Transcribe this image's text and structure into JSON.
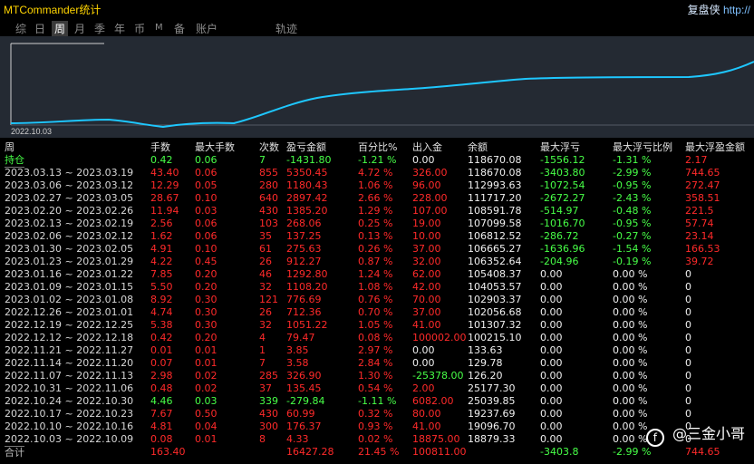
{
  "app": {
    "title": "MTCommander统计",
    "right_title_cn": "复盘侠",
    "right_title_link": "http://"
  },
  "tabs": [
    {
      "label": "综"
    },
    {
      "label": "日"
    },
    {
      "label": "周"
    },
    {
      "label": "月"
    },
    {
      "label": "季"
    },
    {
      "label": "年"
    },
    {
      "label": "币"
    },
    {
      "label": "M"
    },
    {
      "label": "备"
    },
    {
      "label": "账户"
    },
    {
      "label": "轨迹"
    }
  ],
  "active_tab": "周",
  "chart": {
    "start_label": "2022.10.03",
    "line_color": "#1ec7ff",
    "background": "#242a33"
  },
  "table": {
    "headers": [
      "周",
      "手数",
      "最大手数",
      "次数",
      "盈亏金额",
      "百分比%",
      "出入金",
      "余额",
      "最大浮亏",
      "最大浮亏比例",
      "最大浮盈金额"
    ],
    "hold": {
      "label": "持仓",
      "values": [
        "0.42",
        "0.06",
        "7",
        "-1431.80",
        "-1.21 %",
        "0.00",
        "118670.08",
        "-1556.12",
        "-1.31 %",
        "2.17"
      ],
      "colors": [
        "green",
        "green",
        "green",
        "green",
        "green",
        "white",
        "white",
        "green",
        "green",
        "red"
      ]
    },
    "rows": [
      {
        "week": "2023.03.13 ~ 2023.03.19",
        "values": [
          "43.40",
          "0.06",
          "855",
          "5350.45",
          "4.72 %",
          "326.00",
          "118670.08",
          "-3403.80",
          "-2.99 %",
          "744.65"
        ],
        "colors": [
          "red",
          "red",
          "red",
          "red",
          "red",
          "red",
          "white",
          "green",
          "green",
          "red"
        ]
      },
      {
        "week": "2023.03.06 ~ 2023.03.12",
        "values": [
          "12.29",
          "0.05",
          "280",
          "1180.43",
          "1.06 %",
          "96.00",
          "112993.63",
          "-1072.54",
          "-0.95 %",
          "272.47"
        ],
        "colors": [
          "red",
          "red",
          "red",
          "red",
          "red",
          "red",
          "white",
          "green",
          "green",
          "red"
        ]
      },
      {
        "week": "2023.02.27 ~ 2023.03.05",
        "values": [
          "28.67",
          "0.10",
          "640",
          "2897.42",
          "2.66 %",
          "228.00",
          "111717.20",
          "-2672.27",
          "-2.43 %",
          "358.51"
        ],
        "colors": [
          "red",
          "red",
          "red",
          "red",
          "red",
          "red",
          "white",
          "green",
          "green",
          "red"
        ]
      },
      {
        "week": "2023.02.20 ~ 2023.02.26",
        "values": [
          "11.94",
          "0.03",
          "430",
          "1385.20",
          "1.29 %",
          "107.00",
          "108591.78",
          "-514.97",
          "-0.48 %",
          "221.5"
        ],
        "colors": [
          "red",
          "red",
          "red",
          "red",
          "red",
          "red",
          "white",
          "green",
          "green",
          "red"
        ]
      },
      {
        "week": "2023.02.13 ~ 2023.02.19",
        "values": [
          "2.56",
          "0.06",
          "103",
          "268.06",
          "0.25 %",
          "19.00",
          "107099.58",
          "-1016.70",
          "-0.95 %",
          "57.74"
        ],
        "colors": [
          "red",
          "red",
          "red",
          "red",
          "red",
          "red",
          "white",
          "green",
          "green",
          "red"
        ]
      },
      {
        "week": "2023.02.06 ~ 2023.02.12",
        "values": [
          "1.62",
          "0.06",
          "35",
          "137.25",
          "0.13 %",
          "10.00",
          "106812.52",
          "-286.72",
          "-0.27 %",
          "23.14"
        ],
        "colors": [
          "red",
          "red",
          "red",
          "red",
          "red",
          "red",
          "white",
          "green",
          "green",
          "red"
        ]
      },
      {
        "week": "2023.01.30 ~ 2023.02.05",
        "values": [
          "4.91",
          "0.10",
          "61",
          "275.63",
          "0.26 %",
          "37.00",
          "106665.27",
          "-1636.96",
          "-1.54 %",
          "166.53"
        ],
        "colors": [
          "red",
          "red",
          "red",
          "red",
          "red",
          "red",
          "white",
          "green",
          "green",
          "red"
        ]
      },
      {
        "week": "2023.01.23 ~ 2023.01.29",
        "values": [
          "4.22",
          "0.45",
          "26",
          "912.27",
          "0.87 %",
          "32.00",
          "106352.64",
          "-204.96",
          "-0.19 %",
          "39.72"
        ],
        "colors": [
          "red",
          "red",
          "red",
          "red",
          "red",
          "red",
          "white",
          "green",
          "green",
          "red"
        ]
      },
      {
        "week": "2023.01.16 ~ 2023.01.22",
        "values": [
          "7.85",
          "0.20",
          "46",
          "1292.80",
          "1.24 %",
          "62.00",
          "105408.37",
          "0.00",
          "0.00 %",
          "0"
        ],
        "colors": [
          "red",
          "red",
          "red",
          "red",
          "red",
          "red",
          "white",
          "white",
          "white",
          "white"
        ]
      },
      {
        "week": "2023.01.09 ~ 2023.01.15",
        "values": [
          "5.50",
          "0.20",
          "32",
          "1108.20",
          "1.08 %",
          "42.00",
          "104053.57",
          "0.00",
          "0.00 %",
          "0"
        ],
        "colors": [
          "red",
          "red",
          "red",
          "red",
          "red",
          "red",
          "white",
          "white",
          "white",
          "white"
        ]
      },
      {
        "week": "2023.01.02 ~ 2023.01.08",
        "values": [
          "8.92",
          "0.30",
          "121",
          "776.69",
          "0.76 %",
          "70.00",
          "102903.37",
          "0.00",
          "0.00 %",
          "0"
        ],
        "colors": [
          "red",
          "red",
          "red",
          "red",
          "red",
          "red",
          "white",
          "white",
          "white",
          "white"
        ]
      },
      {
        "week": "2022.12.26 ~ 2023.01.01",
        "values": [
          "4.74",
          "0.30",
          "26",
          "712.36",
          "0.70 %",
          "37.00",
          "102056.68",
          "0.00",
          "0.00 %",
          "0"
        ],
        "colors": [
          "red",
          "red",
          "red",
          "red",
          "red",
          "red",
          "white",
          "white",
          "white",
          "white"
        ]
      },
      {
        "week": "2022.12.19 ~ 2022.12.25",
        "values": [
          "5.38",
          "0.30",
          "32",
          "1051.22",
          "1.05 %",
          "41.00",
          "101307.32",
          "0.00",
          "0.00 %",
          "0"
        ],
        "colors": [
          "red",
          "red",
          "red",
          "red",
          "red",
          "red",
          "white",
          "white",
          "white",
          "white"
        ]
      },
      {
        "week": "2022.12.12 ~ 2022.12.18",
        "values": [
          "0.42",
          "0.20",
          "4",
          "79.47",
          "0.08 %",
          "100002.00",
          "100215.10",
          "0.00",
          "0.00 %",
          "0"
        ],
        "colors": [
          "red",
          "red",
          "red",
          "red",
          "red",
          "red",
          "white",
          "white",
          "white",
          "white"
        ]
      },
      {
        "week": "2022.11.21 ~ 2022.11.27",
        "values": [
          "0.01",
          "0.01",
          "1",
          "3.85",
          "2.97 %",
          "0.00",
          "133.63",
          "0.00",
          "0.00 %",
          "0"
        ],
        "colors": [
          "red",
          "red",
          "red",
          "red",
          "red",
          "white",
          "white",
          "white",
          "white",
          "white"
        ]
      },
      {
        "week": "2022.11.14 ~ 2022.11.20",
        "values": [
          "0.07",
          "0.01",
          "7",
          "3.58",
          "2.84 %",
          "0.00",
          "129.78",
          "0.00",
          "0.00 %",
          "0"
        ],
        "colors": [
          "red",
          "red",
          "red",
          "red",
          "red",
          "white",
          "white",
          "white",
          "white",
          "white"
        ]
      },
      {
        "week": "2022.11.07 ~ 2022.11.13",
        "values": [
          "2.98",
          "0.02",
          "285",
          "326.90",
          "1.30 %",
          "-25378.00",
          "126.20",
          "0.00",
          "0.00 %",
          "0"
        ],
        "colors": [
          "red",
          "red",
          "red",
          "red",
          "red",
          "green",
          "white",
          "white",
          "white",
          "white"
        ]
      },
      {
        "week": "2022.10.31 ~ 2022.11.06",
        "values": [
          "0.48",
          "0.02",
          "37",
          "135.45",
          "0.54 %",
          "2.00",
          "25177.30",
          "0.00",
          "0.00 %",
          "0"
        ],
        "colors": [
          "red",
          "red",
          "red",
          "red",
          "red",
          "red",
          "white",
          "white",
          "white",
          "white"
        ]
      },
      {
        "week": "2022.10.24 ~ 2022.10.30",
        "values": [
          "4.46",
          "0.03",
          "339",
          "-279.84",
          "-1.11 %",
          "6082.00",
          "25039.85",
          "0.00",
          "0.00 %",
          "0"
        ],
        "colors": [
          "green",
          "green",
          "green",
          "green",
          "green",
          "red",
          "white",
          "white",
          "white",
          "white"
        ]
      },
      {
        "week": "2022.10.17 ~ 2022.10.23",
        "values": [
          "7.67",
          "0.50",
          "430",
          "60.99",
          "0.32 %",
          "80.00",
          "19237.69",
          "0.00",
          "0.00 %",
          "0"
        ],
        "colors": [
          "red",
          "red",
          "red",
          "red",
          "red",
          "red",
          "white",
          "white",
          "white",
          "white"
        ]
      },
      {
        "week": "2022.10.10 ~ 2022.10.16",
        "values": [
          "4.81",
          "0.04",
          "300",
          "176.37",
          "0.93 %",
          "41.00",
          "19096.70",
          "0.00",
          "0.00 %",
          "0"
        ],
        "colors": [
          "red",
          "red",
          "red",
          "red",
          "red",
          "red",
          "white",
          "white",
          "white",
          "white"
        ]
      },
      {
        "week": "2022.10.03 ~ 2022.10.09",
        "values": [
          "0.08",
          "0.01",
          "8",
          "4.33",
          "0.02 %",
          "18875.00",
          "18879.33",
          "0.00",
          "0.00 %",
          "0"
        ],
        "colors": [
          "red",
          "red",
          "red",
          "red",
          "red",
          "red",
          "white",
          "white",
          "white",
          "white"
        ]
      }
    ],
    "total": {
      "label": "合计",
      "values": [
        "163.40",
        "",
        "16427.28",
        "21.45 %",
        "100811.00",
        "",
        "-3403.8",
        "-2.99 %",
        "744.65"
      ],
      "colors": [
        "red",
        "white",
        "red",
        "red",
        "red",
        "white",
        "green",
        "green",
        "red"
      ]
    }
  },
  "watermark": {
    "platform_icon": "f-icon",
    "text": "@三金小哥"
  }
}
